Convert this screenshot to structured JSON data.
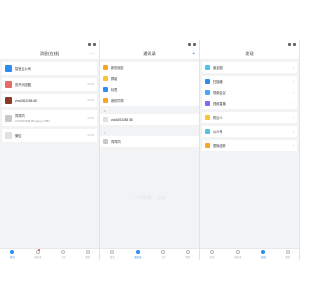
{
  "screens": [
    {
      "title": "消息(在线)",
      "nav_right": "···",
      "items": [
        {
          "name": "智慧云公司",
          "sub": "",
          "time": ""
        },
        {
          "name": "张开乐团圆",
          "sub": "",
          "time": "09:30"
        },
        {
          "name": "zhs6363288 88",
          "sub": "",
          "time": "09:30"
        },
        {
          "name": "同同同",
          "sub": "zhs6363288 88 gdeng 7884",
          "time": "09:30"
        },
        {
          "name": "微信",
          "sub": "",
          "time": "09:30"
        }
      ],
      "tabs": [
        "消息",
        "通讯录",
        "工作",
        "我的"
      ]
    },
    {
      "title": "通讯录",
      "nav_right": "+",
      "group_items": [
        {
          "name": "新的朋友"
        },
        {
          "name": "群组"
        },
        {
          "name": "标签"
        },
        {
          "name": "我的同事"
        }
      ],
      "section_a": "Z",
      "contacts_a": [
        {
          "name": "zsk6363288 88"
        }
      ],
      "section_b": "T",
      "contacts_b": [
        {
          "name": "同同同"
        }
      ],
      "tabs": [
        "消息",
        "通讯录",
        "工作",
        "我的"
      ]
    },
    {
      "title": "发现",
      "groups": [
        [
          {
            "name": "朋友圈"
          }
        ],
        [
          {
            "name": "扫描器"
          },
          {
            "name": "视频会议"
          },
          {
            "name": "视频直播"
          }
        ],
        [
          {
            "name": "附近人"
          }
        ],
        [
          {
            "name": "公众号"
          }
        ],
        [
          {
            "name": "更换皮肤"
          }
        ]
      ],
      "tabs": [
        "消息",
        "通讯录",
        "发现",
        "我的"
      ]
    }
  ],
  "watermark": "广州智慧 · 网络"
}
